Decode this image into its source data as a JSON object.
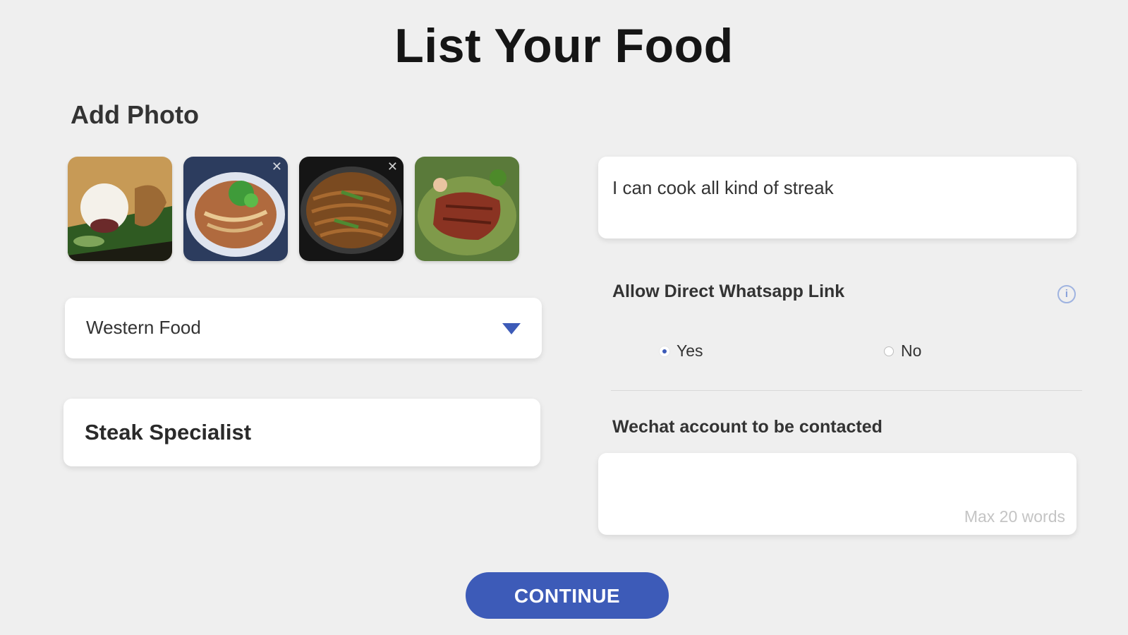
{
  "page": {
    "title": "List Your Food"
  },
  "photos": {
    "label": "Add Photo",
    "items": [
      {
        "name": "rice-dish-photo"
      },
      {
        "name": "noodle-soup-photo"
      },
      {
        "name": "fried-noodles-photo"
      },
      {
        "name": "grilled-meat-photo"
      }
    ],
    "remove_glyph": "✕"
  },
  "category": {
    "selected": "Western Food"
  },
  "food_name": {
    "value": "Steak Specialist"
  },
  "description": {
    "value": "I can cook all kind of streak"
  },
  "whatsapp": {
    "label": "Allow Direct Whatsapp Link",
    "info_glyph": "i",
    "options": [
      {
        "label": "Yes",
        "selected": true
      },
      {
        "label": "No",
        "selected": false
      }
    ]
  },
  "wechat": {
    "label": "Wechat account to be contacted",
    "value": "",
    "hint": "Max 20 words"
  },
  "actions": {
    "continue_label": "CONTINUE"
  },
  "colors": {
    "background": "#efefef",
    "accent": "#3d5bb8",
    "card": "#ffffff"
  }
}
